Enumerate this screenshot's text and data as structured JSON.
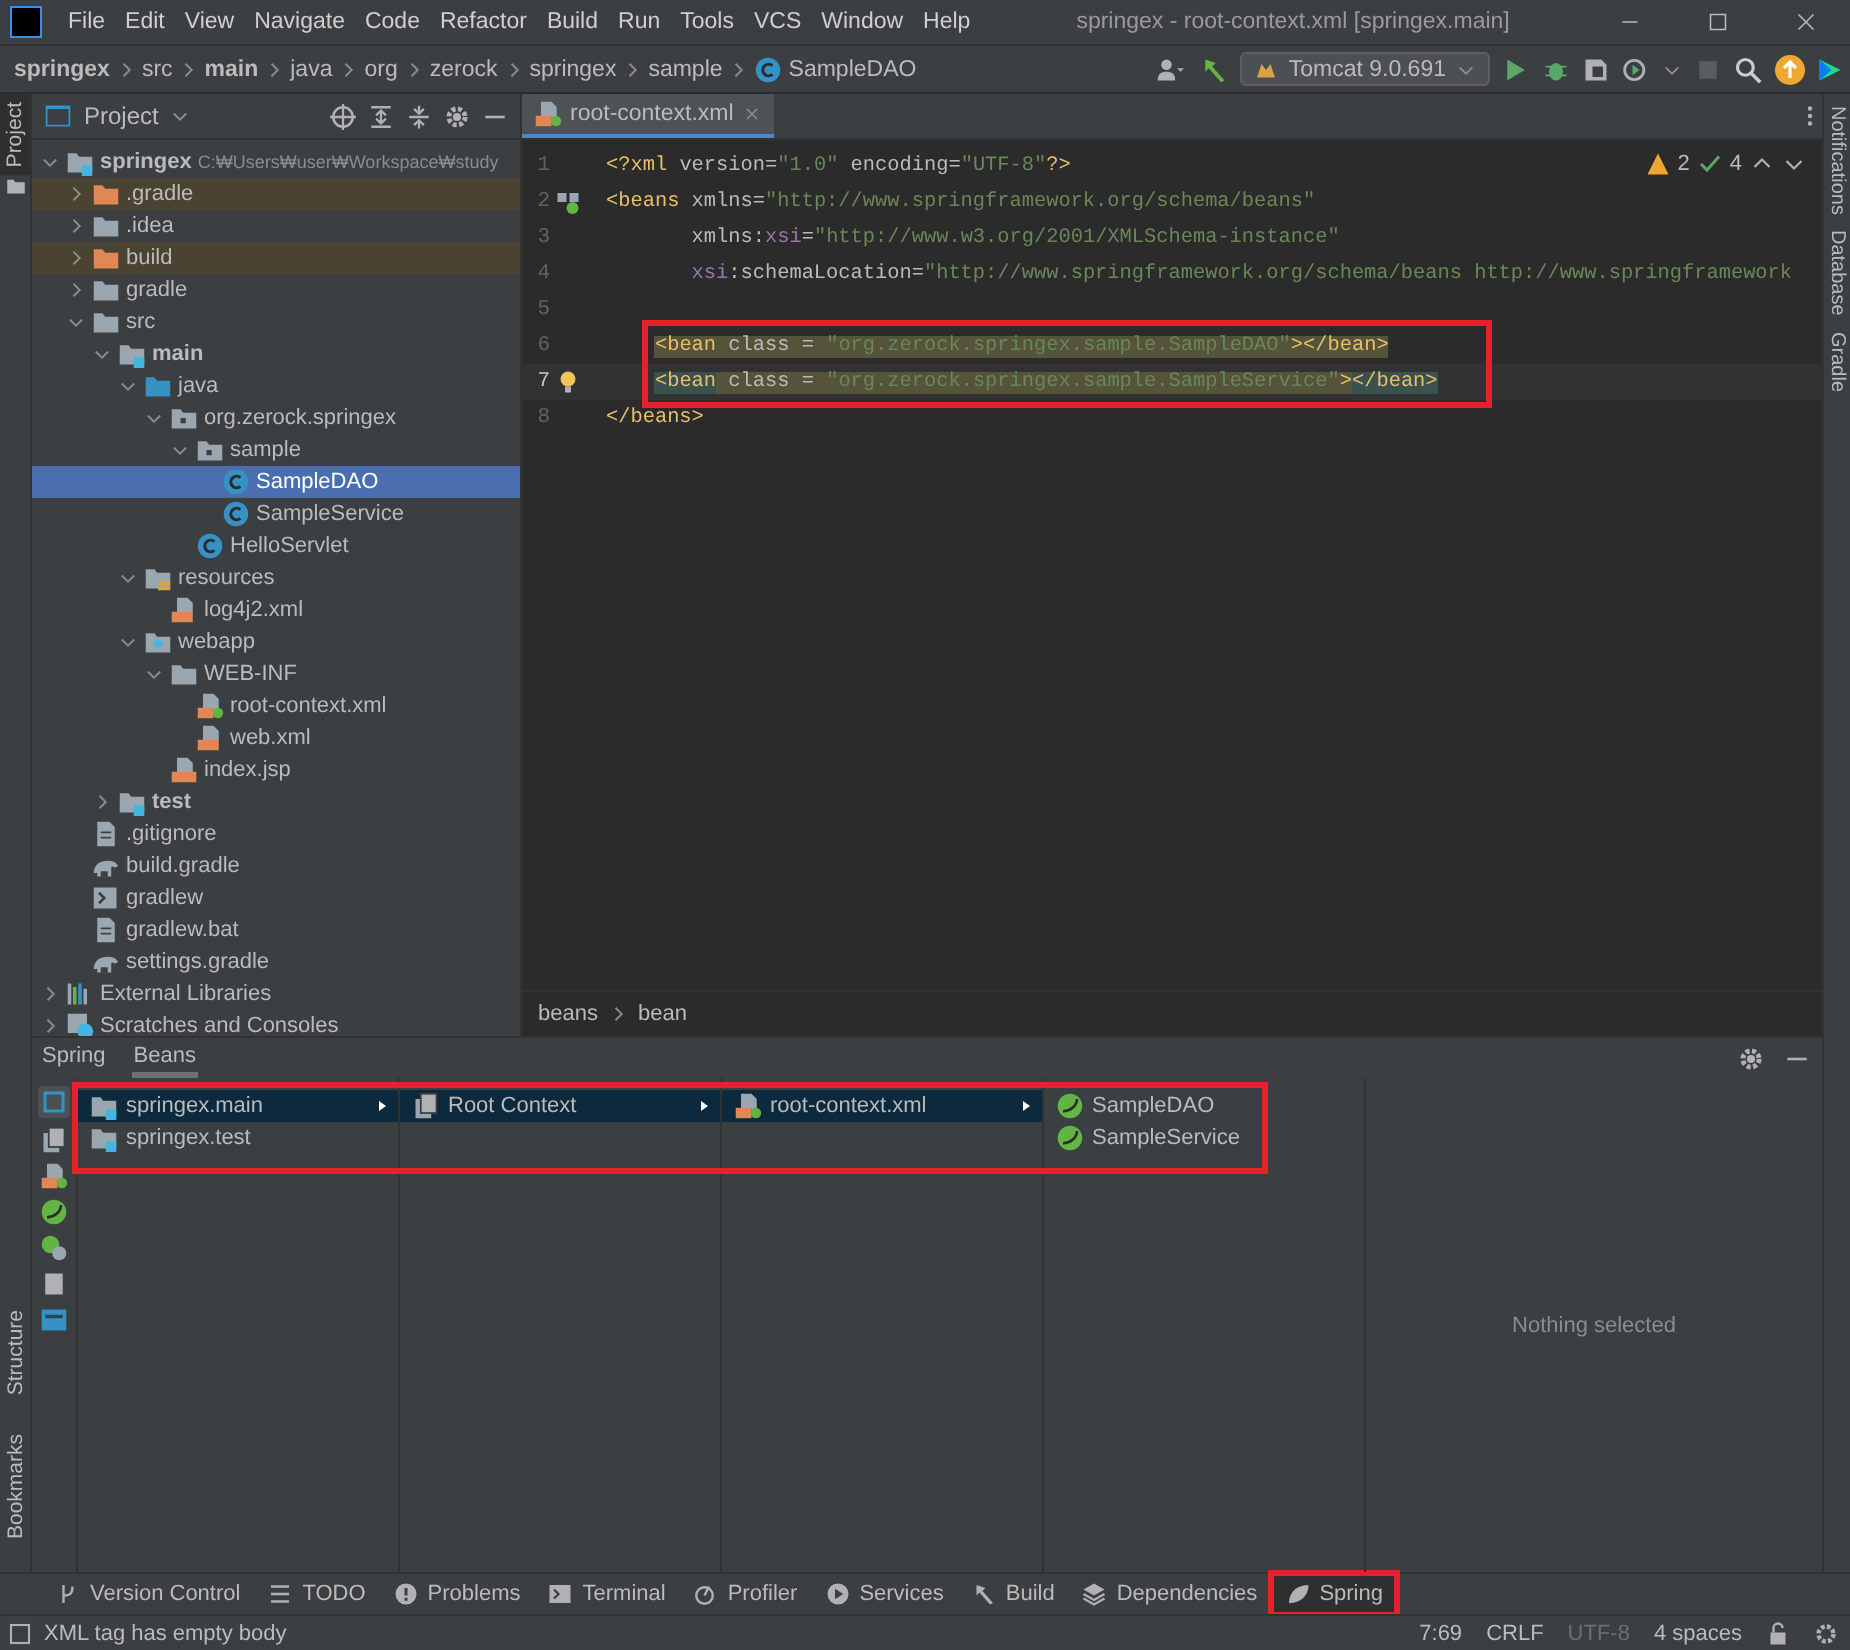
{
  "menu_bar": {
    "items": [
      "File",
      "Edit",
      "View",
      "Navigate",
      "Code",
      "Refactor",
      "Build",
      "Run",
      "Tools",
      "VCS",
      "Window",
      "Help"
    ],
    "title": "springex - root-context.xml [springex.main]"
  },
  "nav_bar": {
    "crumbs": [
      {
        "label": "springex",
        "bold": true,
        "kind": "text"
      },
      {
        "label": "src",
        "bold": false,
        "kind": "text"
      },
      {
        "label": "main",
        "bold": true,
        "kind": "text"
      },
      {
        "label": "java",
        "bold": false,
        "kind": "text"
      },
      {
        "label": "org",
        "bold": false,
        "kind": "text"
      },
      {
        "label": "zerock",
        "bold": false,
        "kind": "text"
      },
      {
        "label": "springex",
        "bold": false,
        "kind": "text"
      },
      {
        "label": "sample",
        "bold": false,
        "kind": "text"
      },
      {
        "label": "SampleDAO",
        "bold": false,
        "kind": "class"
      }
    ],
    "run_config": "Tomcat 9.0.691"
  },
  "side_tabs": {
    "left_top": [
      {
        "label": "Project",
        "selected": true
      }
    ],
    "left_bottom": [
      "Structure",
      "Bookmarks"
    ],
    "right": [
      "Notifications",
      "Database",
      "Gradle"
    ]
  },
  "project": {
    "title": "Project",
    "tree": [
      {
        "label": "springex",
        "kind": "module",
        "bold": true,
        "hint": "C:₩Users₩user₩Workspace₩study",
        "expanded": true,
        "selected": false,
        "excluded": false,
        "children": [
          {
            "label": ".gradle",
            "kind": "folder-excluded",
            "expanded": false,
            "selected": false,
            "excluded": true
          },
          {
            "label": ".idea",
            "kind": "folder",
            "expanded": false,
            "selected": false,
            "excluded": false
          },
          {
            "label": "build",
            "kind": "folder-excluded",
            "expanded": false,
            "selected": false,
            "excluded": true
          },
          {
            "label": "gradle",
            "kind": "folder",
            "expanded": false,
            "selected": false,
            "excluded": false
          },
          {
            "label": "src",
            "kind": "folder",
            "expanded": true,
            "selected": false,
            "excluded": false,
            "children": [
              {
                "label": "main",
                "kind": "module",
                "bold": true,
                "expanded": true,
                "selected": false,
                "excluded": false,
                "children": [
                  {
                    "label": "java",
                    "kind": "source-root",
                    "expanded": true,
                    "selected": false,
                    "excluded": false,
                    "children": [
                      {
                        "label": "org.zerock.springex",
                        "kind": "package",
                        "expanded": true,
                        "selected": false,
                        "excluded": false,
                        "children": [
                          {
                            "label": "sample",
                            "kind": "package",
                            "expanded": true,
                            "selected": false,
                            "excluded": false,
                            "children": [
                              {
                                "label": "SampleDAO",
                                "kind": "class",
                                "selected": true,
                                "excluded": false
                              },
                              {
                                "label": "SampleService",
                                "kind": "class",
                                "selected": false,
                                "excluded": false
                              }
                            ]
                          },
                          {
                            "label": "HelloServlet",
                            "kind": "class",
                            "selected": false,
                            "excluded": false
                          }
                        ]
                      }
                    ]
                  },
                  {
                    "label": "resources",
                    "kind": "resources",
                    "expanded": true,
                    "selected": false,
                    "excluded": false,
                    "children": [
                      {
                        "label": "log4j2.xml",
                        "kind": "xml",
                        "selected": false,
                        "excluded": false
                      }
                    ]
                  },
                  {
                    "label": "webapp",
                    "kind": "web",
                    "expanded": true,
                    "selected": false,
                    "excluded": false,
                    "children": [
                      {
                        "label": "WEB-INF",
                        "kind": "folder",
                        "expanded": true,
                        "selected": false,
                        "excluded": false,
                        "children": [
                          {
                            "label": "root-context.xml",
                            "kind": "spring-xml",
                            "selected": false,
                            "excluded": false
                          },
                          {
                            "label": "web.xml",
                            "kind": "xml",
                            "selected": false,
                            "excluded": false
                          }
                        ]
                      },
                      {
                        "label": "index.jsp",
                        "kind": "jsp",
                        "selected": false,
                        "excluded": false
                      }
                    ]
                  }
                ]
              },
              {
                "label": "test",
                "kind": "module",
                "bold": true,
                "expanded": false,
                "selected": false,
                "excluded": false
              }
            ]
          },
          {
            "label": ".gitignore",
            "kind": "file",
            "selected": false,
            "excluded": false
          },
          {
            "label": "build.gradle",
            "kind": "gradle",
            "selected": false,
            "excluded": false
          },
          {
            "label": "gradlew",
            "kind": "script",
            "selected": false,
            "excluded": false
          },
          {
            "label": "gradlew.bat",
            "kind": "file",
            "selected": false,
            "excluded": false
          },
          {
            "label": "settings.gradle",
            "kind": "gradle",
            "selected": false,
            "excluded": false
          }
        ]
      },
      {
        "label": "External Libraries",
        "kind": "libraries",
        "expanded": false,
        "selected": false,
        "excluded": false
      },
      {
        "label": "Scratches and Consoles",
        "kind": "scratches",
        "expanded": false,
        "selected": false,
        "excluded": false
      }
    ]
  },
  "editor": {
    "tab": "root-context.xml",
    "warnings": "2",
    "checks": "4",
    "lines": [
      {
        "number": "1",
        "kind": "plain",
        "highlighted": false,
        "current": false,
        "annotated": false,
        "tokens": [
          {
            "text": "<?xml",
            "kind": "tag"
          },
          {
            "text": " version=",
            "kind": "attr"
          },
          {
            "text": "\"1.0\"",
            "kind": "value"
          },
          {
            "text": " encoding=",
            "kind": "attr"
          },
          {
            "text": "\"UTF-8\"",
            "kind": "value"
          },
          {
            "text": "?>",
            "kind": "tag"
          }
        ]
      },
      {
        "number": "2",
        "kind": "bean_marker",
        "highlighted": false,
        "current": false,
        "annotated": false,
        "tokens": [
          {
            "text": "<beans",
            "kind": "tag"
          },
          {
            "text": " xmlns=",
            "kind": "attr"
          },
          {
            "text": "\"http://www.springframework.org/schema/beans\"",
            "kind": "value"
          }
        ]
      },
      {
        "number": "3",
        "kind": "plain",
        "highlighted": false,
        "current": false,
        "annotated": false,
        "tokens": [
          {
            "text": "       xmlns:",
            "kind": "attr"
          },
          {
            "text": "xsi",
            "kind": "ns"
          },
          {
            "text": "=",
            "kind": "attr"
          },
          {
            "text": "\"http://www.w3.org/2001/XMLSchema-instance\"",
            "kind": "value"
          }
        ]
      },
      {
        "number": "4",
        "kind": "plain",
        "highlighted": false,
        "current": false,
        "annotated": false,
        "tokens": [
          {
            "text": "       xsi",
            "kind": "ns"
          },
          {
            "text": ":schemaLocation=",
            "kind": "attr"
          },
          {
            "text": "\"http://www.springframework.org/schema/beans http://www.springframework",
            "kind": "value"
          }
        ]
      },
      {
        "number": "5",
        "kind": "plain",
        "current": false,
        "annotated": false
      },
      {
        "number": "6",
        "kind": "plain",
        "highlighted": true,
        "current": false,
        "annotated": true,
        "tokens": [
          {
            "text": "    <bean",
            "kind": "tag"
          },
          {
            "text": " class = ",
            "kind": "attr"
          },
          {
            "text": "\"org.zerock.springex.sample.SampleDAO\"",
            "kind": "value"
          },
          {
            "text": "></bean>",
            "kind": "tag"
          }
        ]
      },
      {
        "number": "7",
        "kind": "bulb_marker",
        "highlighted": true,
        "current": true,
        "annotated": true,
        "tokens": [
          {
            "text": "    <bean",
            "kind": "tag_match"
          },
          {
            "text": " class = ",
            "kind": "attr"
          },
          {
            "text": "\"org.zerock.springex.sample.SampleService\"",
            "kind": "value"
          },
          {
            "text": ">",
            "kind": "tag"
          },
          {
            "text": "</bean>",
            "kind": "tag_match"
          }
        ]
      },
      {
        "number": "8",
        "kind": "plain",
        "highlighted": false,
        "current": false,
        "annotated": false,
        "tokens": [
          {
            "text": "</beans>",
            "kind": "tag"
          }
        ]
      }
    ],
    "breadcrumb": [
      "beans",
      "bean"
    ]
  },
  "spring_panel": {
    "tabs": [
      {
        "label": "Spring",
        "selected": false
      },
      {
        "label": "Beans",
        "selected": true
      }
    ],
    "annotated": true,
    "columns": [
      {
        "items": [
          {
            "label": "springex.main",
            "kind": "module",
            "selected": true,
            "expandable": true
          },
          {
            "label": "springex.test",
            "kind": "module",
            "selected": false,
            "expandable": false
          }
        ]
      },
      {
        "items": [
          {
            "label": "Root Context",
            "kind": "context",
            "selected": true,
            "expandable": true
          }
        ]
      },
      {
        "items": [
          {
            "label": "root-context.xml",
            "kind": "spring-xml",
            "selected": true,
            "expandable": true
          }
        ]
      },
      {
        "items": [
          {
            "label": "SampleDAO",
            "kind": "bean",
            "selected": false,
            "expandable": false
          },
          {
            "label": "SampleService",
            "kind": "bean",
            "selected": false,
            "expandable": false
          }
        ]
      }
    ],
    "detail": "Nothing selected"
  },
  "tool_windows": [
    {
      "label": "Version Control",
      "kind": "vcs",
      "selected": false,
      "annotated": false
    },
    {
      "label": "TODO",
      "kind": "list",
      "selected": false,
      "annotated": false
    },
    {
      "label": "Problems",
      "kind": "problems",
      "selected": false,
      "annotated": false
    },
    {
      "label": "Terminal",
      "kind": "terminal",
      "selected": false,
      "annotated": false
    },
    {
      "label": "Profiler",
      "kind": "profiler",
      "selected": false,
      "annotated": false
    },
    {
      "label": "Services",
      "kind": "services",
      "selected": false,
      "annotated": false
    },
    {
      "label": "Build",
      "kind": "build",
      "selected": false,
      "annotated": false
    },
    {
      "label": "Dependencies",
      "kind": "deps",
      "selected": false,
      "annotated": false
    },
    {
      "label": "Spring",
      "kind": "spring",
      "selected": true,
      "annotated": true
    }
  ],
  "status_bar": {
    "message": "XML tag has empty body",
    "position": "7:69",
    "line_separator": "CRLF",
    "encoding": {
      "label": "UTF-8",
      "disabled": true
    },
    "indent": "4 spaces"
  }
}
